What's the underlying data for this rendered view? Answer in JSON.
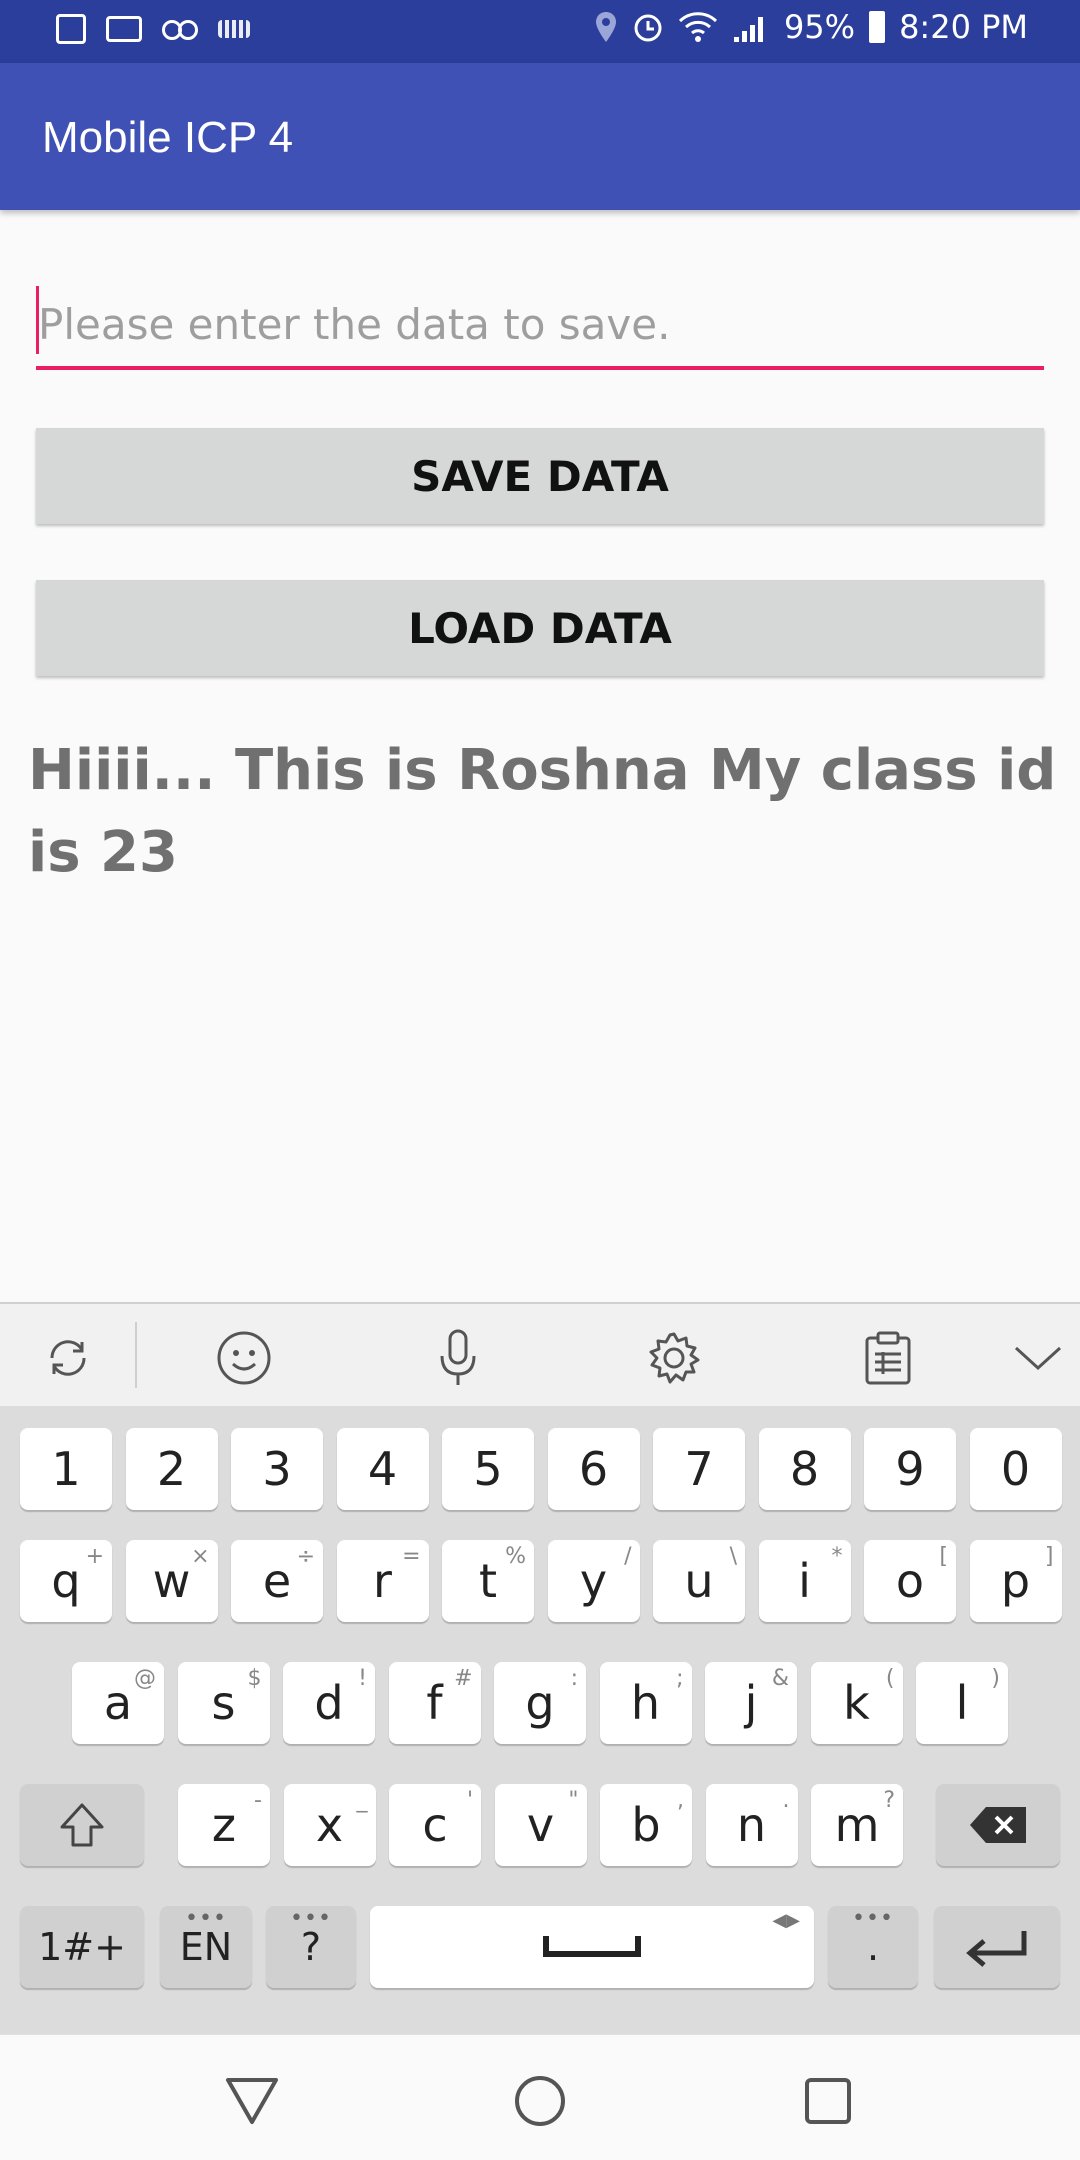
{
  "status_bar": {
    "battery": "95%",
    "time": "8:20 PM"
  },
  "app_bar": {
    "title": "Mobile ICP 4"
  },
  "form": {
    "input_placeholder": "Please enter the data to save.",
    "input_value": "",
    "save_label": "SAVE DATA",
    "load_label": "LOAD DATA",
    "result_text": "Hiiii... This is Roshna My class id is 23"
  },
  "keyboard": {
    "row_numbers": [
      "1",
      "2",
      "3",
      "4",
      "5",
      "6",
      "7",
      "8",
      "9",
      "0"
    ],
    "row1": [
      {
        "k": "q",
        "s": "+"
      },
      {
        "k": "w",
        "s": "×"
      },
      {
        "k": "e",
        "s": "÷"
      },
      {
        "k": "r",
        "s": "="
      },
      {
        "k": "t",
        "s": "%"
      },
      {
        "k": "y",
        "s": "/"
      },
      {
        "k": "u",
        "s": "\\"
      },
      {
        "k": "i",
        "s": "*"
      },
      {
        "k": "o",
        "s": "["
      },
      {
        "k": "p",
        "s": "]"
      }
    ],
    "row2": [
      {
        "k": "a",
        "s": "@"
      },
      {
        "k": "s",
        "s": "$"
      },
      {
        "k": "d",
        "s": "!"
      },
      {
        "k": "f",
        "s": "#"
      },
      {
        "k": "g",
        "s": ":"
      },
      {
        "k": "h",
        "s": ";"
      },
      {
        "k": "j",
        "s": "&"
      },
      {
        "k": "k",
        "s": "("
      },
      {
        "k": "l",
        "s": ")"
      }
    ],
    "row3": [
      {
        "k": "z",
        "s": "-"
      },
      {
        "k": "x",
        "s": "_"
      },
      {
        "k": "c",
        "s": "'"
      },
      {
        "k": "v",
        "s": "\""
      },
      {
        "k": "b",
        "s": ","
      },
      {
        "k": "n",
        "s": "."
      },
      {
        "k": "m",
        "s": "?"
      }
    ],
    "symbols_label": "1#+",
    "language_label": "EN",
    "question_label": "?",
    "period_label": "."
  }
}
